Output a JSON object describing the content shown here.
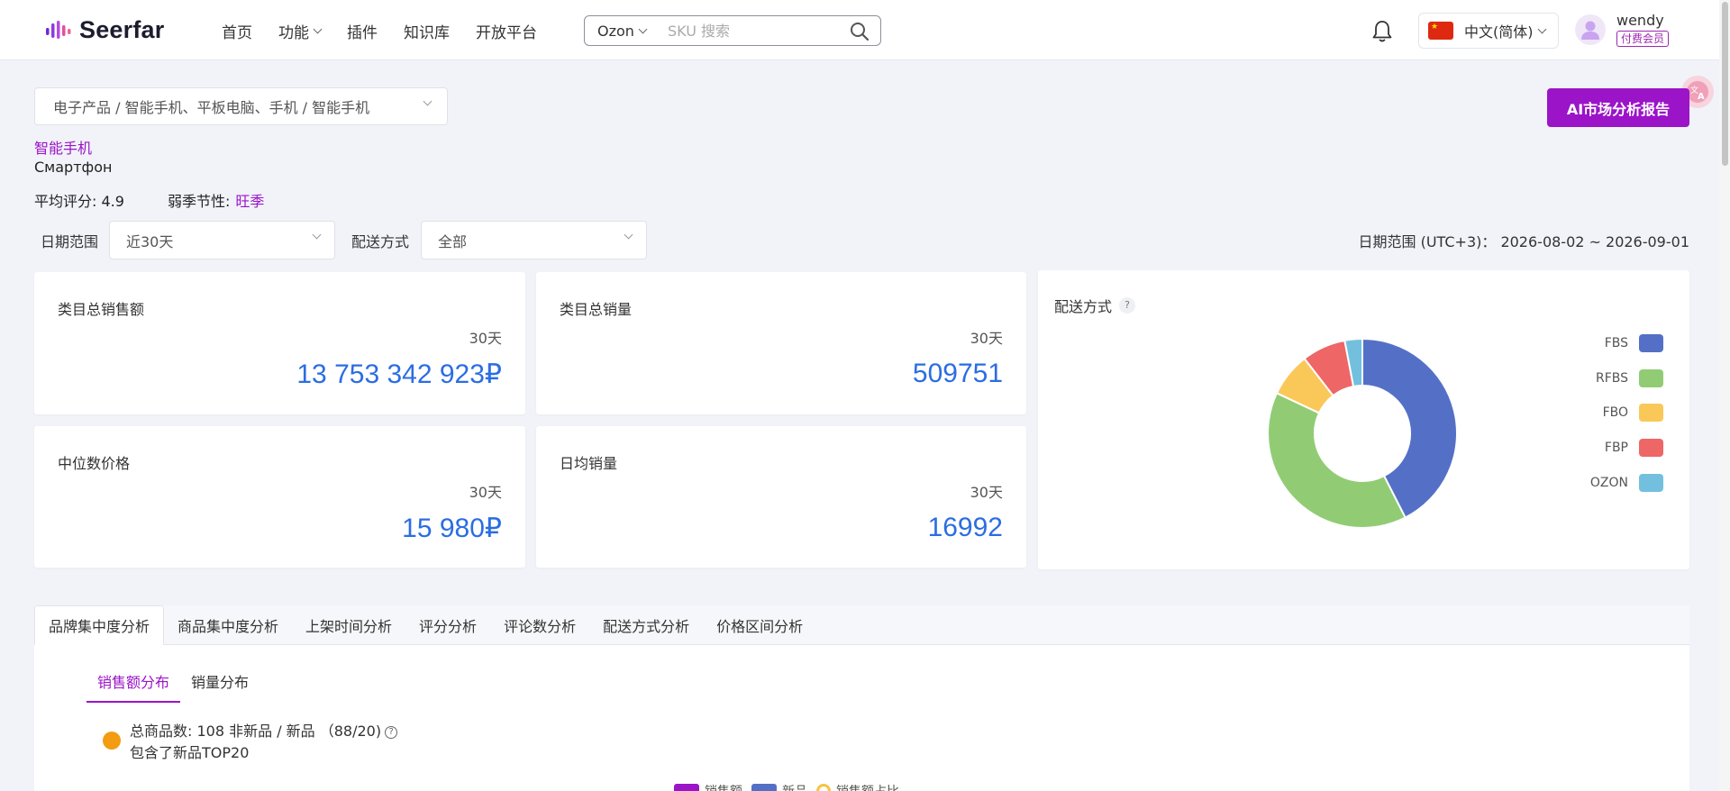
{
  "header": {
    "logo_text": "Seerfar",
    "nav": [
      {
        "label": "首页",
        "dropdown": false
      },
      {
        "label": "功能",
        "dropdown": true
      },
      {
        "label": "插件",
        "dropdown": false
      },
      {
        "label": "知识库",
        "dropdown": false
      },
      {
        "label": "开放平台",
        "dropdown": false
      }
    ],
    "search": {
      "platform": "Ozon",
      "placeholder": "SKU 搜索"
    },
    "language": "中文(简体)",
    "user": {
      "name": "wendy",
      "badge": "付费会员"
    }
  },
  "filters": {
    "category_path": "电子产品 / 智能手机、平板电脑、手机 / 智能手机",
    "ai_button_label": "AI市场分析报告",
    "category_name": "智能手机",
    "category_name_ru": "Смартфон",
    "avg_rating_label": "平均评分: 4.9",
    "season_label": "弱季节性:",
    "season_value": "旺季",
    "date_label": "日期范围",
    "date_value": "近30天",
    "delivery_label": "配送方式",
    "delivery_value": "全部",
    "date_range_text": "日期范围 (UTC+3)： 2026-08-02 ~ 2026-09-01"
  },
  "cards": {
    "total_sales": {
      "title": "类目总销售额",
      "period": "30天",
      "value": "13 753 342 923₽"
    },
    "total_volume": {
      "title": "类目总销量",
      "period": "30天",
      "value": "509751"
    },
    "median_price": {
      "title": "中位数价格",
      "period": "30天",
      "value": "15 980₽"
    },
    "daily_volume": {
      "title": "日均销量",
      "period": "30天",
      "value": "16992"
    },
    "delivery": {
      "title": "配送方式",
      "help": "?"
    }
  },
  "chart_data": {
    "type": "pie",
    "donut": true,
    "categories": [
      "FBS",
      "RFBS",
      "FBO",
      "FBP",
      "OZON"
    ],
    "values": [
      42.5,
      39.5,
      7.5,
      7.5,
      3.0
    ],
    "colors": [
      "#5470c6",
      "#91cc75",
      "#fac858",
      "#ee6666",
      "#73c0de"
    ],
    "legend_position": "right",
    "title": ""
  },
  "analysis": {
    "tabs": [
      "品牌集中度分析",
      "商品集中度分析",
      "上架时间分析",
      "评分分析",
      "评论数分析",
      "配送方式分析",
      "价格区间分析"
    ],
    "active_tab": 0,
    "subtabs": [
      "销售额分布",
      "销量分布"
    ],
    "active_subtab": 0,
    "summary_line1": "总商品数: 108 非新品 / 新品 （88/20)",
    "summary_line2": "包含了新品TOP20",
    "chart_legend": [
      "销售额",
      "新品",
      "销售额占比"
    ],
    "chart_legend_colors": [
      "#9b14c8",
      "#5470c6",
      "#f5c542"
    ]
  }
}
